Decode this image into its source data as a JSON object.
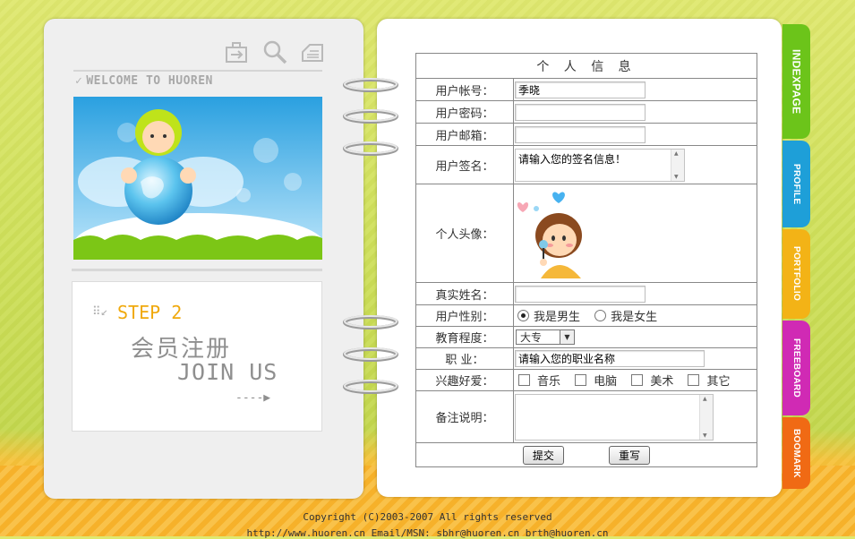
{
  "left": {
    "welcome_text": "WELCOME TO HUOREN",
    "step_label": "STEP 2",
    "step_title_cn": "会员注册",
    "step_title_en": "JOIN US",
    "step_arrow": "----▶",
    "icons": [
      "login-icon",
      "search-icon",
      "notepad-icon"
    ]
  },
  "form": {
    "title": "个 人 信 息",
    "account_label": "用户帐号：",
    "account_value": "季晓",
    "password_label": "用户密码：",
    "email_label": "用户邮箱：",
    "signature_label": "用户签名：",
    "signature_value": "请输入您的签名信息！",
    "avatar_label": "个人头像：",
    "realname_label": "真实姓名：",
    "gender_label": "用户性别：",
    "gender_male": "我是男生",
    "gender_female": "我是女生",
    "gender_selected": "male",
    "education_label": "教育程度：",
    "education_value": "大专",
    "job_label": "职 业：",
    "job_value": "请输入您的职业名称",
    "hobby_label": "兴趣好爱：",
    "hobbies": [
      "音乐",
      "电脑",
      "美术",
      "其它"
    ],
    "remark_label": "备注说明：",
    "submit_label": "提交",
    "reset_label": "重写"
  },
  "tabs": [
    {
      "label": "INDEXPAGE",
      "color": "#6cc41a"
    },
    {
      "label": "PROFILE",
      "color": "#1e9fd8"
    },
    {
      "label": "PORTFOLIO",
      "color": "#f3b316"
    },
    {
      "label": "FREEBOARD",
      "color": "#d02ab4"
    },
    {
      "label": "BOOMARK",
      "color": "#f06a14"
    }
  ],
  "footer": {
    "copyright": "Copyright (C)2003-2007  All rights reserved",
    "contact": "http://www.huoren.cn  Email/MSN: sbhr@huoren.cn brth@huoren.cn"
  }
}
